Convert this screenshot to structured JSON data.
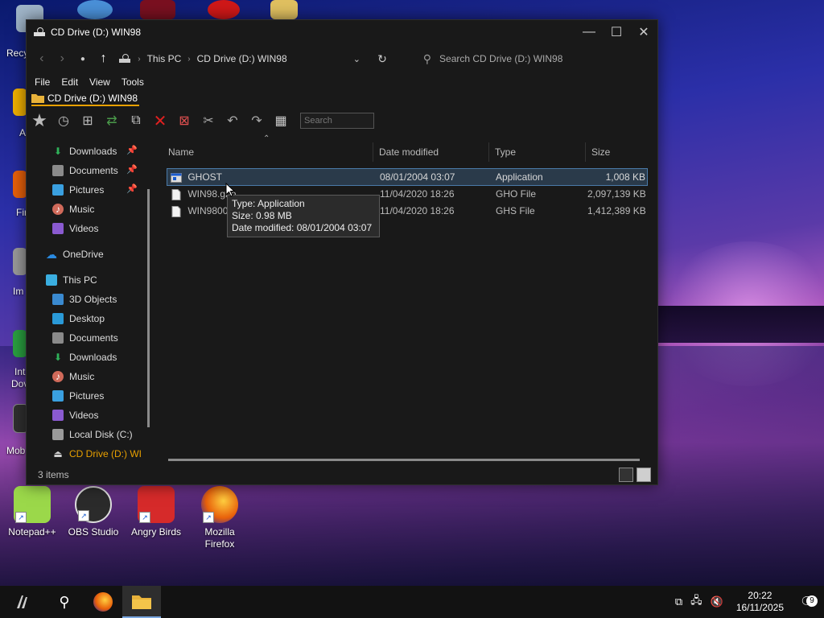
{
  "desktop": {
    "icons_bottom": [
      {
        "label": "Notepad++",
        "icon": "notepadpp-icon",
        "color": "#9bd84a"
      },
      {
        "label": "OBS Studio",
        "icon": "obs-icon",
        "color": "#2b2b2b"
      },
      {
        "label": "Angry Birds",
        "icon": "angry-birds-icon",
        "color": "#d62a2a"
      },
      {
        "label": "Mozilla Firefox",
        "icon": "firefox-icon",
        "color": "#e8600a"
      }
    ],
    "edge_labels": [
      "Recy",
      "A",
      "Fir",
      "Im",
      "Int",
      "Dov",
      "Mob"
    ]
  },
  "window": {
    "title": "CD Drive (D:) WIN98",
    "nav": {
      "address_parts": [
        "This PC",
        "CD Drive (D:) WIN98"
      ],
      "search_placeholder": "Search CD Drive (D:) WIN98"
    },
    "menu": [
      "File",
      "Edit",
      "View",
      "Tools"
    ],
    "breadcrumb": "CD Drive (D:) WIN98",
    "toolbar_search_placeholder": "Search",
    "sidebar": [
      {
        "label": "Downloads",
        "icon": "download-icon",
        "pinned": true,
        "color": "#2fb35a"
      },
      {
        "label": "Documents",
        "icon": "documents-icon",
        "pinned": true,
        "color": "#8a8a8a"
      },
      {
        "label": "Pictures",
        "icon": "pictures-icon",
        "pinned": true,
        "color": "#3aa0e0"
      },
      {
        "label": "Music",
        "icon": "music-icon",
        "pinned": false,
        "color": "#d06a5a"
      },
      {
        "label": "Videos",
        "icon": "videos-icon",
        "pinned": false,
        "color": "#8a5ad0"
      },
      {
        "label": "OneDrive",
        "icon": "onedrive-icon",
        "pinned": false,
        "color": "#2a8ae0"
      },
      {
        "label": "This PC",
        "icon": "this-pc-icon",
        "pinned": false,
        "color": "#3aaee0"
      },
      {
        "label": "3D Objects",
        "icon": "3d-objects-icon",
        "pinned": false,
        "color": "#3a8ad0"
      },
      {
        "label": "Desktop",
        "icon": "desktop-icon",
        "pinned": false,
        "color": "#2a9ad8"
      },
      {
        "label": "Documents",
        "icon": "documents-icon",
        "pinned": false,
        "color": "#8a8a8a"
      },
      {
        "label": "Downloads",
        "icon": "download-icon",
        "pinned": false,
        "color": "#2fb35a"
      },
      {
        "label": "Music",
        "icon": "music-icon",
        "pinned": false,
        "color": "#d06a5a"
      },
      {
        "label": "Pictures",
        "icon": "pictures-icon",
        "pinned": false,
        "color": "#3aa0e0"
      },
      {
        "label": "Videos",
        "icon": "videos-icon",
        "pinned": false,
        "color": "#8a5ad0"
      },
      {
        "label": "Local Disk (C:)",
        "icon": "local-disk-icon",
        "pinned": false,
        "color": "#9a9a9a"
      },
      {
        "label": "CD Drive (D:) WI",
        "icon": "cd-drive-icon",
        "pinned": false,
        "color": "#cfcfcf"
      }
    ],
    "columns": [
      "Name",
      "Date modified",
      "Type",
      "Size"
    ],
    "files": [
      {
        "name": "GHOST",
        "date": "08/01/2004 03:07",
        "type": "Application",
        "size": "1,008 KB",
        "icon": "application-icon",
        "selected": true
      },
      {
        "name": "WIN98.gho",
        "date": "11/04/2020 18:26",
        "type": "GHO File",
        "size": "2,097,139 KB",
        "icon": "file-icon",
        "selected": false
      },
      {
        "name": "WIN98001.ghs",
        "date": "11/04/2020 18:26",
        "type": "GHS File",
        "size": "1,412,389 KB",
        "icon": "file-icon",
        "selected": false
      }
    ],
    "tooltip": {
      "line1": "Type: Application",
      "line2": "Size: 0.98 MB",
      "line3": "Date modified: 08/01/2004 03:07"
    },
    "status": "3 items"
  },
  "taskbar": {
    "time": "20:22",
    "date": "16/11/2025",
    "notification_count": "9"
  },
  "colors": {
    "accent": "#e8a000",
    "selection": "#2a3a4a",
    "window_bg": "#191919"
  }
}
